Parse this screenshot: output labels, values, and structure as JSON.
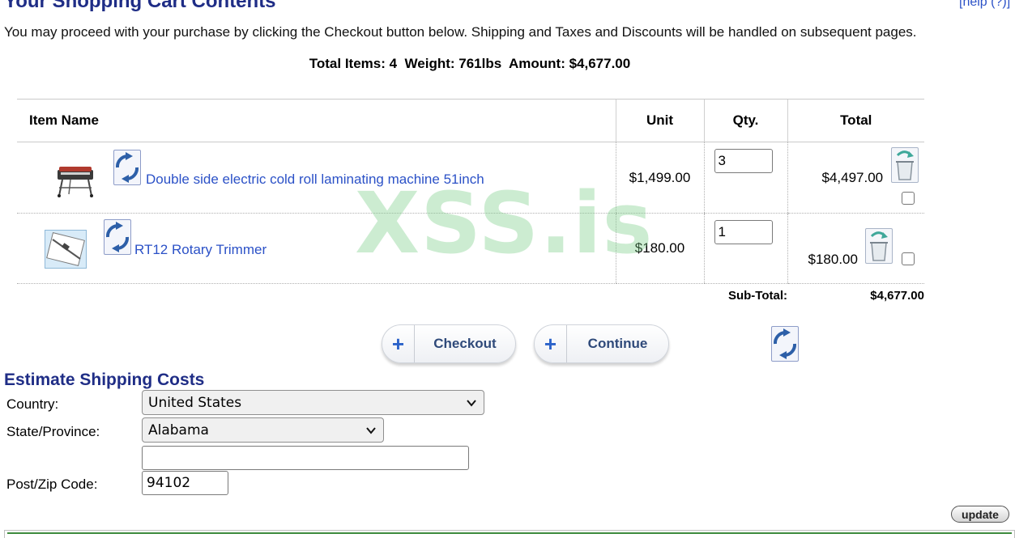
{
  "header": {
    "title": "Your Shopping Cart Contents",
    "help_link": "[help (?)]",
    "intro": "You may proceed with your purchase by clicking the Checkout button below. Shipping and Taxes and Discounts will be handled on subsequent pages.",
    "summary": "Total Items: 4  Weight: 761lbs  Amount: $4,677.00"
  },
  "cart": {
    "columns": {
      "item_name": "Item Name",
      "unit": "Unit",
      "qty": "Qty.",
      "total": "Total"
    },
    "items": [
      {
        "name": "Double side electric cold roll laminating machine 51inch",
        "unit": "$1,499.00",
        "qty": "3",
        "total": "$4,497.00",
        "remove_checked": false,
        "thumbnail_icon": "laminating-machine-icon"
      },
      {
        "name": "RT12 Rotary Trimmer",
        "unit": "$180.00",
        "qty": "1",
        "total": "$180.00",
        "remove_checked": false,
        "thumbnail_icon": "rotary-trimmer-icon"
      }
    ],
    "subtotal_label": "Sub-Total:",
    "subtotal_value": "$4,677.00"
  },
  "watermark": "XSS.is",
  "actions": {
    "checkout_label": "Checkout",
    "continue_label": "Continue"
  },
  "shipping": {
    "title": "Estimate Shipping Costs",
    "country_label": "Country:",
    "country_value": "United States",
    "state_label": "State/Province:",
    "state_value": "Alabama",
    "extra_value": "",
    "zip_label": "Post/Zip Code:",
    "zip_value": "94102",
    "update_label": "update"
  },
  "colors": {
    "heading": "#1f2d86",
    "link": "#2b51c7",
    "watermark": "#78cd87"
  }
}
